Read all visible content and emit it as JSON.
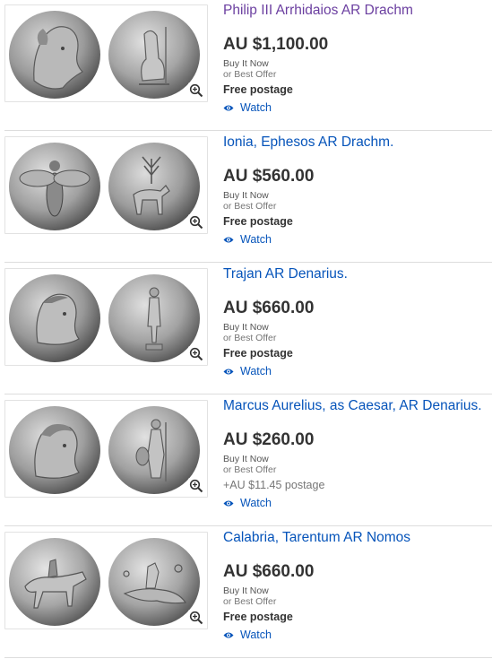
{
  "listings": [
    {
      "title": "Philip III Arrhidaios AR Drachm",
      "visited": true,
      "price": "AU $1,100.00",
      "format": "Buy It Now",
      "best_offer": "or Best Offer",
      "shipping": "Free postage",
      "shipping_paid": false,
      "watch": "Watch"
    },
    {
      "title": "Ionia, Ephesos AR Drachm.",
      "visited": false,
      "price": "AU $560.00",
      "format": "Buy It Now",
      "best_offer": "or Best Offer",
      "shipping": "Free postage",
      "shipping_paid": false,
      "watch": "Watch"
    },
    {
      "title": "Trajan AR Denarius.",
      "visited": false,
      "price": "AU $660.00",
      "format": "Buy It Now",
      "best_offer": "or Best Offer",
      "shipping": "Free postage",
      "shipping_paid": false,
      "watch": "Watch"
    },
    {
      "title": "Marcus Aurelius, as Caesar, AR Denarius.",
      "visited": false,
      "price": "AU $260.00",
      "format": "Buy It Now",
      "best_offer": "or Best Offer",
      "shipping": "+AU $11.45 postage",
      "shipping_paid": true,
      "watch": "Watch"
    },
    {
      "title": "Calabria, Tarentum AR Nomos",
      "visited": false,
      "price": "AU $660.00",
      "format": "Buy It Now",
      "best_offer": "or Best Offer",
      "shipping": "Free postage",
      "shipping_paid": false,
      "watch": "Watch"
    }
  ],
  "icons": {
    "zoom": "zoom-in-icon",
    "watch": "eye-icon"
  },
  "colors": {
    "link": "#0654ba",
    "visited_link": "#6b3fa0",
    "price": "#333333",
    "muted": "#767676"
  }
}
